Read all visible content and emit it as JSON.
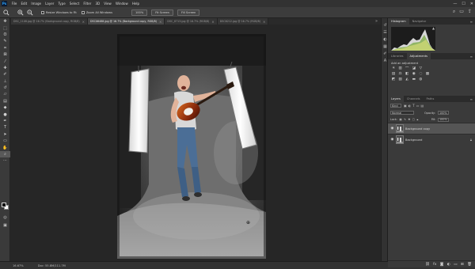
{
  "app": {
    "logo_text": "Ps"
  },
  "menu": [
    "File",
    "Edit",
    "Image",
    "Layer",
    "Type",
    "Select",
    "Filter",
    "3D",
    "View",
    "Window",
    "Help"
  ],
  "window_controls": [
    "—",
    "☐",
    "✕"
  ],
  "options_bar": {
    "resize_windows_label": "Resize Windows to Fit",
    "zoom_all_windows_label": "Zoom All Windows",
    "zoom_100_label": "100%",
    "fit_screen_label": "Fit Screen",
    "fill_screen_label": "Fill Screen"
  },
  "tabs": [
    {
      "label": "DSC_1108.jpg @ 16.7% (Background copy, RGB/8)",
      "active": false
    },
    {
      "label": "DSC06488.jpg @ 16.7% (Background copy, RGB/8)",
      "active": true
    },
    {
      "label": "DSC_8713.jpg @ 16.7% (RGB/8)",
      "active": false
    },
    {
      "label": "DSC6212.jpg @ 16.7% (RGB/8)",
      "active": false
    }
  ],
  "status_bar": {
    "zoom": "16.67%",
    "doc_info": "Doc: 55.8M/111.7M"
  },
  "panels": {
    "histogram_tabs": [
      "Histogram",
      "Navigator"
    ],
    "adjustments_tabs": [
      "Libraries",
      "Adjustments"
    ],
    "adjustments_title": "Add an adjustment",
    "layers_tabs": [
      "Layers",
      "Channels",
      "Paths"
    ],
    "kind_label": "Kind",
    "blend_mode": "Normal",
    "opacity_label": "Opacity:",
    "opacity_value": "100%",
    "lock_label": "Lock:",
    "fill_label": "Fill:",
    "fill_value": "100%",
    "layers": [
      {
        "name": "Background copy",
        "selected": true
      },
      {
        "name": "Background",
        "selected": false
      }
    ]
  },
  "colors": {
    "accent": "#31a8ff",
    "ui_dark": "#282828",
    "panel": "#3a3a3a"
  }
}
